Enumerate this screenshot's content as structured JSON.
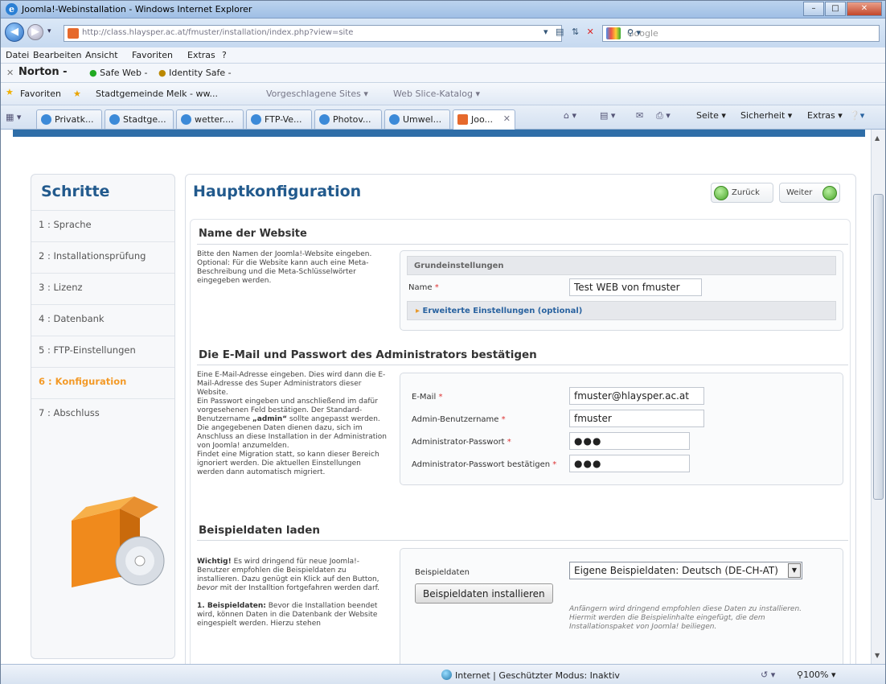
{
  "window": {
    "title": "Joomla!-Webinstallation - Windows Internet Explorer"
  },
  "address": {
    "url": "http://class.hlaysper.ac.at/fmuster/installation/index.php?view=site",
    "search_placeholder": "Google"
  },
  "menu": [
    "Datei",
    "Bearbeiten",
    "Ansicht",
    "Favoriten",
    "Extras",
    "?"
  ],
  "toolbar": {
    "norton": "Norton -",
    "safe_web": "Safe Web -",
    "identity_safe": "Identity Safe -"
  },
  "favorites": {
    "label": "Favoriten",
    "items": [
      "Stadtgemeinde Melk - ww...",
      "Vorgeschlagene Sites ▾",
      "Web Slice-Katalog ▾"
    ]
  },
  "tabs": [
    "Privatk...",
    "Stadtge...",
    "wetter....",
    "FTP-Ve...",
    "Photov...",
    "Umwel...",
    "Joo..."
  ],
  "commands": {
    "seite": "Seite ▾",
    "sicherheit": "Sicherheit ▾",
    "extras": "Extras ▾"
  },
  "sidebar": {
    "title": "Schritte",
    "steps": [
      "1 : Sprache",
      "2 : Installationsprüfung",
      "3 : Lizenz",
      "4 : Datenbank",
      "5 : FTP-Einstellungen",
      "6 : Konfiguration",
      "7 : Abschluss"
    ]
  },
  "main": {
    "title": "Hauptkonfiguration",
    "back_label": "Zurück",
    "next_label": "Weiter",
    "site": {
      "heading": "Name der Website",
      "desc": "Bitte den Namen der Joomla!-Website eingeben.\nOptional: Für die Website kann auch eine Meta-Beschreibung und die Meta-Schlüsselwörter eingegeben werden.",
      "panel_head": "Grundeinstellungen",
      "name_label": "Name",
      "name_value": "Test WEB von fmuster",
      "advanced": "Erweiterte Einstellungen (optional)"
    },
    "admin": {
      "heading": "Die E-Mail und Passwort des Administrators bestätigen",
      "desc_pre": "Eine E-Mail-Adresse eingeben. Dies wird dann die E-Mail-Adresse des Super Administrators dieser Website.\nEin Passwort eingeben und anschließend im dafür vorgesehenen Feld bestätigen. Der Standard-Benutzername ",
      "desc_bold": "„admin“",
      "desc_post": " sollte angepasst werden. Die angegebenen Daten dienen dazu, sich im Anschluss an diese Installation in der Administration von Joomla! anzumelden.\nFindet eine Migration statt, so kann dieser Bereich ignoriert werden. Die aktuellen Einstellungen werden dann automatisch migriert.",
      "email_label": "E-Mail",
      "email_value": "fmuster@hlaysper.ac.at",
      "user_label": "Admin-Benutzername",
      "user_value": "fmuster",
      "pw_label": "Administrator-Passwort",
      "pw_value": "●●●",
      "pw2_label": "Administrator-Passwort bestätigen",
      "pw2_value": "●●●"
    },
    "sample": {
      "heading": "Beispieldaten laden",
      "desc_b1": "Wichtig!",
      "desc_1": " Es wird dringend für neue Joomla!-Benutzer empfohlen die Beispieldaten zu installieren. Dazu genügt ein Klick auf den Button, ",
      "desc_i": "bevor",
      "desc_2": " mit der Installtion fortgefahren werden darf.",
      "desc_b2": "1. Beispieldaten:",
      "desc_3": " Bevor die Installation beendet wird, können Daten in die Datenbank der Website eingespielt werden. Hierzu stehen",
      "label": "Beispieldaten",
      "select_value": "Eigene Beispieldaten: Deutsch (DE-CH-AT)",
      "install_button": "Beispieldaten installieren",
      "note": "Anfängern wird dringend empfohlen diese Daten zu installieren. Hiermit werden die Beispielinhalte eingefügt, die dem Installationspaket von Joomla! beiliegen."
    }
  },
  "status": {
    "zone": "Internet | Geschützter Modus: Inaktiv",
    "zoom": "100%"
  }
}
